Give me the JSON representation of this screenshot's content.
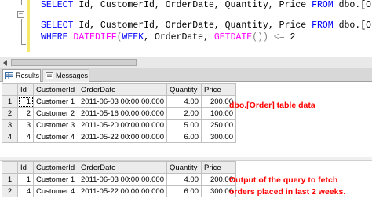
{
  "editor": {
    "line1": {
      "kw1": "SELECT",
      "cols": " Id, CustomerId, OrderDate, Quantity, Price ",
      "kw2": "FROM",
      "table": " dbo.[Order]"
    },
    "line2": {
      "kw1": "SELECT",
      "cols": " Id, CustomerId, OrderDate, Quantity, Price ",
      "kw2": "FROM",
      "table": " dbo.[Order]"
    },
    "line3": {
      "kw1": "WHERE",
      "fn1": "DATEDIFF",
      "paren1": "(",
      "arg1": "WEEK",
      "comma": ", OrderDate, ",
      "fn2": "GETDATE",
      "rest": "()) ",
      "op": "<=",
      "val": " 2"
    }
  },
  "tabs": {
    "results": "Results",
    "messages": "Messages"
  },
  "columns": [
    "Id",
    "CustomerId",
    "OrderDate",
    "Quantity",
    "Price"
  ],
  "grid1": {
    "rows": [
      {
        "rn": "1",
        "id": "1",
        "cust": "Customer 1",
        "date": "2011-06-03 00:00:00.000",
        "qty": "4.00",
        "price": "200.00"
      },
      {
        "rn": "2",
        "id": "2",
        "cust": "Customer 2",
        "date": "2011-05-16 00:00:00.000",
        "qty": "2.00",
        "price": "100.00"
      },
      {
        "rn": "3",
        "id": "3",
        "cust": "Customer 3",
        "date": "2011-05-20 00:00:00.000",
        "qty": "5.00",
        "price": "250.00"
      },
      {
        "rn": "4",
        "id": "4",
        "cust": "Customer 4",
        "date": "2011-05-22 00:00:00.000",
        "qty": "6.00",
        "price": "300.00"
      }
    ],
    "note": "dbo.[Order] table data"
  },
  "grid2": {
    "rows": [
      {
        "rn": "1",
        "id": "1",
        "cust": "Customer 1",
        "date": "2011-06-03 00:00:00.000",
        "qty": "4.00",
        "price": "200.00"
      },
      {
        "rn": "2",
        "id": "4",
        "cust": "Customer 4",
        "date": "2011-05-22 00:00:00.000",
        "qty": "6.00",
        "price": "300.00"
      }
    ],
    "note_line1": "Output of the query to fetch",
    "note_line2": "orders placed in last 2 weeks."
  },
  "colors": {
    "keyword": "#0000ff",
    "function": "#ff00ff",
    "operator": "#808080",
    "annotation": "#ff0000"
  }
}
